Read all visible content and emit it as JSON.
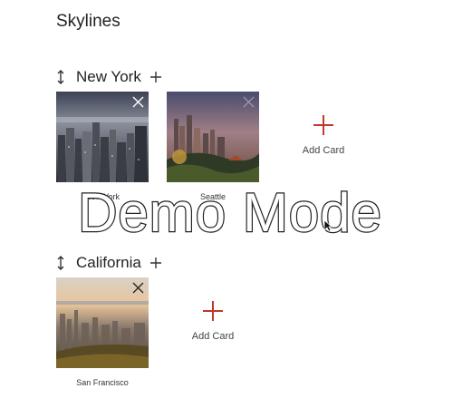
{
  "page": {
    "title": "Skylines"
  },
  "groups": [
    {
      "title": "New York",
      "cards": [
        {
          "label": "New York"
        },
        {
          "label": "Seattle"
        }
      ],
      "add_card_label": "Add Card"
    },
    {
      "title": "California",
      "cards": [
        {
          "label": "San Francisco"
        }
      ],
      "add_card_label": "Add Card"
    }
  ],
  "watermark": {
    "text": "Demo Mode"
  },
  "icons": {
    "drag": "drag-handle-icon",
    "plus": "plus-icon",
    "close": "close-icon"
  },
  "colors": {
    "accent": "#c0392b",
    "text": "#222222"
  }
}
